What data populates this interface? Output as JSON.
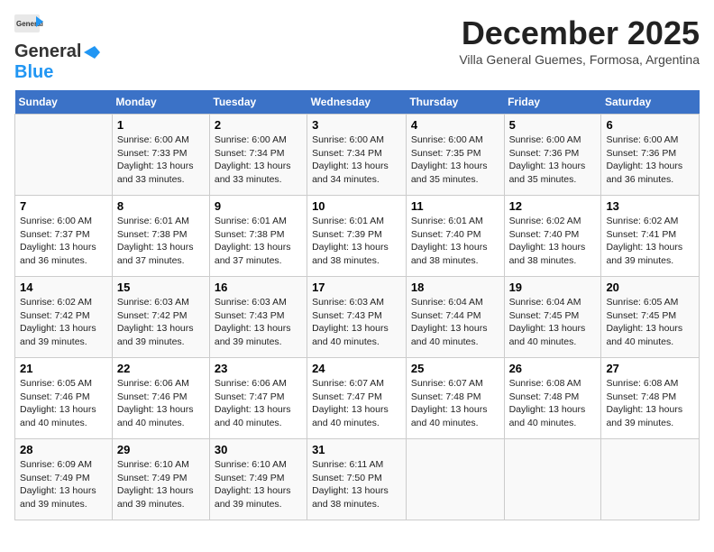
{
  "header": {
    "logo_general": "General",
    "logo_blue": "Blue",
    "month": "December 2025",
    "location": "Villa General Guemes, Formosa, Argentina"
  },
  "weekdays": [
    "Sunday",
    "Monday",
    "Tuesday",
    "Wednesday",
    "Thursday",
    "Friday",
    "Saturday"
  ],
  "weeks": [
    [
      {
        "day": "",
        "sunrise": "",
        "sunset": "",
        "daylight": ""
      },
      {
        "day": "1",
        "sunrise": "Sunrise: 6:00 AM",
        "sunset": "Sunset: 7:33 PM",
        "daylight": "Daylight: 13 hours and 33 minutes."
      },
      {
        "day": "2",
        "sunrise": "Sunrise: 6:00 AM",
        "sunset": "Sunset: 7:34 PM",
        "daylight": "Daylight: 13 hours and 33 minutes."
      },
      {
        "day": "3",
        "sunrise": "Sunrise: 6:00 AM",
        "sunset": "Sunset: 7:34 PM",
        "daylight": "Daylight: 13 hours and 34 minutes."
      },
      {
        "day": "4",
        "sunrise": "Sunrise: 6:00 AM",
        "sunset": "Sunset: 7:35 PM",
        "daylight": "Daylight: 13 hours and 35 minutes."
      },
      {
        "day": "5",
        "sunrise": "Sunrise: 6:00 AM",
        "sunset": "Sunset: 7:36 PM",
        "daylight": "Daylight: 13 hours and 35 minutes."
      },
      {
        "day": "6",
        "sunrise": "Sunrise: 6:00 AM",
        "sunset": "Sunset: 7:36 PM",
        "daylight": "Daylight: 13 hours and 36 minutes."
      }
    ],
    [
      {
        "day": "7",
        "sunrise": "Sunrise: 6:00 AM",
        "sunset": "Sunset: 7:37 PM",
        "daylight": "Daylight: 13 hours and 36 minutes."
      },
      {
        "day": "8",
        "sunrise": "Sunrise: 6:01 AM",
        "sunset": "Sunset: 7:38 PM",
        "daylight": "Daylight: 13 hours and 37 minutes."
      },
      {
        "day": "9",
        "sunrise": "Sunrise: 6:01 AM",
        "sunset": "Sunset: 7:38 PM",
        "daylight": "Daylight: 13 hours and 37 minutes."
      },
      {
        "day": "10",
        "sunrise": "Sunrise: 6:01 AM",
        "sunset": "Sunset: 7:39 PM",
        "daylight": "Daylight: 13 hours and 38 minutes."
      },
      {
        "day": "11",
        "sunrise": "Sunrise: 6:01 AM",
        "sunset": "Sunset: 7:40 PM",
        "daylight": "Daylight: 13 hours and 38 minutes."
      },
      {
        "day": "12",
        "sunrise": "Sunrise: 6:02 AM",
        "sunset": "Sunset: 7:40 PM",
        "daylight": "Daylight: 13 hours and 38 minutes."
      },
      {
        "day": "13",
        "sunrise": "Sunrise: 6:02 AM",
        "sunset": "Sunset: 7:41 PM",
        "daylight": "Daylight: 13 hours and 39 minutes."
      }
    ],
    [
      {
        "day": "14",
        "sunrise": "Sunrise: 6:02 AM",
        "sunset": "Sunset: 7:42 PM",
        "daylight": "Daylight: 13 hours and 39 minutes."
      },
      {
        "day": "15",
        "sunrise": "Sunrise: 6:03 AM",
        "sunset": "Sunset: 7:42 PM",
        "daylight": "Daylight: 13 hours and 39 minutes."
      },
      {
        "day": "16",
        "sunrise": "Sunrise: 6:03 AM",
        "sunset": "Sunset: 7:43 PM",
        "daylight": "Daylight: 13 hours and 39 minutes."
      },
      {
        "day": "17",
        "sunrise": "Sunrise: 6:03 AM",
        "sunset": "Sunset: 7:43 PM",
        "daylight": "Daylight: 13 hours and 40 minutes."
      },
      {
        "day": "18",
        "sunrise": "Sunrise: 6:04 AM",
        "sunset": "Sunset: 7:44 PM",
        "daylight": "Daylight: 13 hours and 40 minutes."
      },
      {
        "day": "19",
        "sunrise": "Sunrise: 6:04 AM",
        "sunset": "Sunset: 7:45 PM",
        "daylight": "Daylight: 13 hours and 40 minutes."
      },
      {
        "day": "20",
        "sunrise": "Sunrise: 6:05 AM",
        "sunset": "Sunset: 7:45 PM",
        "daylight": "Daylight: 13 hours and 40 minutes."
      }
    ],
    [
      {
        "day": "21",
        "sunrise": "Sunrise: 6:05 AM",
        "sunset": "Sunset: 7:46 PM",
        "daylight": "Daylight: 13 hours and 40 minutes."
      },
      {
        "day": "22",
        "sunrise": "Sunrise: 6:06 AM",
        "sunset": "Sunset: 7:46 PM",
        "daylight": "Daylight: 13 hours and 40 minutes."
      },
      {
        "day": "23",
        "sunrise": "Sunrise: 6:06 AM",
        "sunset": "Sunset: 7:47 PM",
        "daylight": "Daylight: 13 hours and 40 minutes."
      },
      {
        "day": "24",
        "sunrise": "Sunrise: 6:07 AM",
        "sunset": "Sunset: 7:47 PM",
        "daylight": "Daylight: 13 hours and 40 minutes."
      },
      {
        "day": "25",
        "sunrise": "Sunrise: 6:07 AM",
        "sunset": "Sunset: 7:48 PM",
        "daylight": "Daylight: 13 hours and 40 minutes."
      },
      {
        "day": "26",
        "sunrise": "Sunrise: 6:08 AM",
        "sunset": "Sunset: 7:48 PM",
        "daylight": "Daylight: 13 hours and 40 minutes."
      },
      {
        "day": "27",
        "sunrise": "Sunrise: 6:08 AM",
        "sunset": "Sunset: 7:48 PM",
        "daylight": "Daylight: 13 hours and 39 minutes."
      }
    ],
    [
      {
        "day": "28",
        "sunrise": "Sunrise: 6:09 AM",
        "sunset": "Sunset: 7:49 PM",
        "daylight": "Daylight: 13 hours and 39 minutes."
      },
      {
        "day": "29",
        "sunrise": "Sunrise: 6:10 AM",
        "sunset": "Sunset: 7:49 PM",
        "daylight": "Daylight: 13 hours and 39 minutes."
      },
      {
        "day": "30",
        "sunrise": "Sunrise: 6:10 AM",
        "sunset": "Sunset: 7:49 PM",
        "daylight": "Daylight: 13 hours and 39 minutes."
      },
      {
        "day": "31",
        "sunrise": "Sunrise: 6:11 AM",
        "sunset": "Sunset: 7:50 PM",
        "daylight": "Daylight: 13 hours and 38 minutes."
      },
      {
        "day": "",
        "sunrise": "",
        "sunset": "",
        "daylight": ""
      },
      {
        "day": "",
        "sunrise": "",
        "sunset": "",
        "daylight": ""
      },
      {
        "day": "",
        "sunrise": "",
        "sunset": "",
        "daylight": ""
      }
    ]
  ]
}
